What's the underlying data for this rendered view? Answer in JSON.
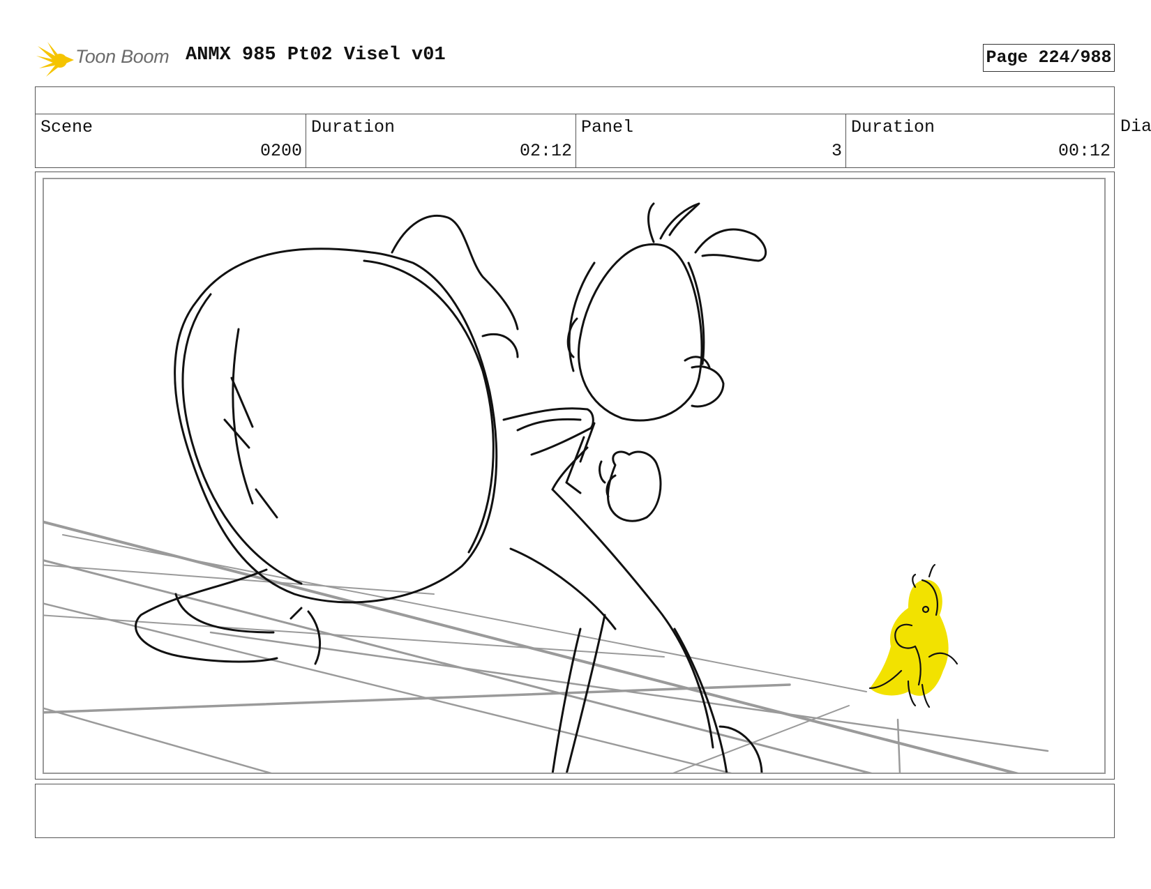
{
  "header": {
    "logo_text": "Toon Boom",
    "doc_title": "ANMX 985 Pt02 Visel v01",
    "page_label": "Page 224/988"
  },
  "info": {
    "scene_label": "Scene",
    "scene_value": "0200",
    "scene_duration_label": "Duration",
    "scene_duration_value": "02:12",
    "panel_label": "Panel",
    "panel_value": "3",
    "panel_duration_label": "Duration",
    "panel_duration_value": "00:12",
    "dialogue_label": "Dia"
  },
  "colors": {
    "logo_accent": "#f5c400",
    "sketch_line": "#111111",
    "floor_line": "#9a9a9a",
    "highlight": "#f2e200"
  },
  "icons": [
    "toon-boom-logo-icon"
  ]
}
